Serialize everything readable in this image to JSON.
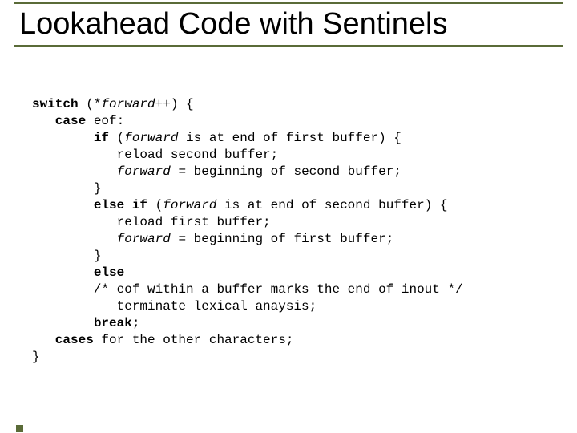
{
  "title": "Lookahead Code with Sentinels",
  "code": {
    "l1a": "switch",
    "l1b": " (*",
    "l1c": "forward",
    "l1d": "++) {",
    "l2a": "   case",
    "l2b": " eof:",
    "l3a": "        if",
    "l3b": " (",
    "l3c": "forward",
    "l3d": " is at end of first buffer) {",
    "l4": "           reload second buffer;",
    "l5a": "           ",
    "l5b": "forward",
    "l5c": " = beginning of second buffer;",
    "l6": "        }",
    "l7a": "        else if",
    "l7b": " (",
    "l7c": "forward",
    "l7d": " is at end of second buffer) {",
    "l8": "           reload first buffer;",
    "l9a": "           ",
    "l9b": "forward",
    "l9c": " = beginning of first buffer;",
    "l10": "        }",
    "l11a": "        else",
    "l12": "        /* eof within a buffer marks the end of inout */",
    "l13": "           terminate lexical anaysis;",
    "l14a": "        break",
    "l14b": ";",
    "l15a": "   cases",
    "l15b": " for the other characters;",
    "l16": "}"
  }
}
